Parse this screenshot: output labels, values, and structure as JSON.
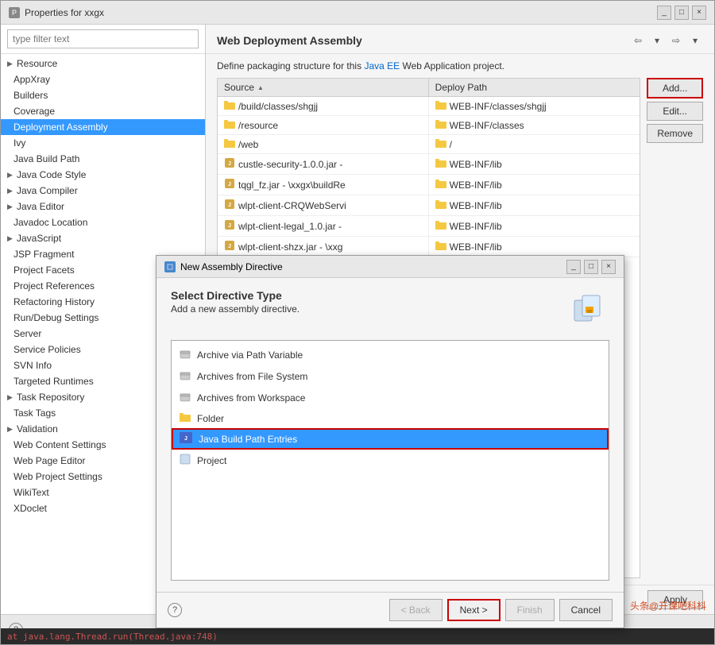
{
  "window": {
    "title": "Properties for xxgx",
    "title_icon": "P",
    "controls": [
      "_",
      "□",
      "×"
    ]
  },
  "sidebar": {
    "filter_placeholder": "type filter text",
    "items": [
      {
        "label": "Resource",
        "has_arrow": true,
        "selected": false
      },
      {
        "label": "AppXray",
        "has_arrow": false,
        "selected": false
      },
      {
        "label": "Builders",
        "has_arrow": false,
        "selected": false
      },
      {
        "label": "Coverage",
        "has_arrow": false,
        "selected": false
      },
      {
        "label": "Deployment Assembly",
        "has_arrow": false,
        "selected": true
      },
      {
        "label": "Ivy",
        "has_arrow": false,
        "selected": false
      },
      {
        "label": "Java Build Path",
        "has_arrow": false,
        "selected": false
      },
      {
        "label": "Java Code Style",
        "has_arrow": true,
        "selected": false
      },
      {
        "label": "Java Compiler",
        "has_arrow": true,
        "selected": false
      },
      {
        "label": "Java Editor",
        "has_arrow": true,
        "selected": false
      },
      {
        "label": "Javadoc Location",
        "has_arrow": false,
        "selected": false
      },
      {
        "label": "JavaScript",
        "has_arrow": true,
        "selected": false
      },
      {
        "label": "JSP Fragment",
        "has_arrow": false,
        "selected": false
      },
      {
        "label": "Project Facets",
        "has_arrow": false,
        "selected": false
      },
      {
        "label": "Project References",
        "has_arrow": false,
        "selected": false
      },
      {
        "label": "Refactoring History",
        "has_arrow": false,
        "selected": false
      },
      {
        "label": "Run/Debug Settings",
        "has_arrow": false,
        "selected": false
      },
      {
        "label": "Server",
        "has_arrow": false,
        "selected": false
      },
      {
        "label": "Service Policies",
        "has_arrow": false,
        "selected": false
      },
      {
        "label": "SVN Info",
        "has_arrow": false,
        "selected": false
      },
      {
        "label": "Targeted Runtimes",
        "has_arrow": false,
        "selected": false
      },
      {
        "label": "Task Repository",
        "has_arrow": true,
        "selected": false
      },
      {
        "label": "Task Tags",
        "has_arrow": false,
        "selected": false
      },
      {
        "label": "Validation",
        "has_arrow": true,
        "selected": false
      },
      {
        "label": "Web Content Settings",
        "has_arrow": false,
        "selected": false
      },
      {
        "label": "Web Page Editor",
        "has_arrow": false,
        "selected": false
      },
      {
        "label": "Web Project Settings",
        "has_arrow": false,
        "selected": false
      },
      {
        "label": "WikiText",
        "has_arrow": false,
        "selected": false
      },
      {
        "label": "XDoclet",
        "has_arrow": false,
        "selected": false
      }
    ]
  },
  "panel": {
    "title": "Web Deployment Assembly",
    "description": "Define packaging structure for this Java EE Web Application project.",
    "description_link": "Java EE",
    "table": {
      "col_source": "Source",
      "col_deploy_path": "Deploy Path",
      "rows": [
        {
          "source": "/build/classes/shgjj",
          "deploy": "WEB-INF/classes/shgjj",
          "source_icon": "folder",
          "deploy_icon": "folder"
        },
        {
          "source": "/resource",
          "deploy": "WEB-INF/classes",
          "source_icon": "folder",
          "deploy_icon": "folder"
        },
        {
          "source": "/web",
          "deploy": "/",
          "source_icon": "folder",
          "deploy_icon": "folder"
        },
        {
          "source": "custle-security-1.0.0.jar -",
          "deploy": "WEB-INF/lib",
          "source_icon": "jar",
          "deploy_icon": "folder"
        },
        {
          "source": "tqgl_fz.jar - \\xxgx\\buildRe",
          "deploy": "WEB-INF/lib",
          "source_icon": "jar",
          "deploy_icon": "folder"
        },
        {
          "source": "wlpt-client-CRQWebServi",
          "deploy": "WEB-INF/lib",
          "source_icon": "jar",
          "deploy_icon": "folder"
        },
        {
          "source": "wlpt-client-legal_1.0.jar -",
          "deploy": "WEB-INF/lib",
          "source_icon": "jar",
          "deploy_icon": "folder"
        },
        {
          "source": "wlpt-client-shzx.jar - \\xxg",
          "deploy": "WEB-INF/lib",
          "source_icon": "jar",
          "deploy_icon": "folder"
        }
      ]
    },
    "buttons": {
      "add": "Add...",
      "edit": "Edit...",
      "remove": "Remove",
      "apply": "Apply"
    }
  },
  "modal": {
    "title": "New Assembly Directive",
    "heading": "Select Directive Type",
    "subtitle": "Add a new assembly directive.",
    "directives": [
      {
        "label": "Archive via Path Variable",
        "icon": "archive",
        "selected": false,
        "highlighted": false
      },
      {
        "label": "Archives from File System",
        "icon": "archive",
        "selected": false,
        "highlighted": false
      },
      {
        "label": "Archives from Workspace",
        "icon": "archive",
        "selected": false,
        "highlighted": false
      },
      {
        "label": "Folder",
        "icon": "folder",
        "selected": false,
        "highlighted": false
      },
      {
        "label": "Java Build Path Entries",
        "icon": "java",
        "selected": true,
        "highlighted": true
      },
      {
        "label": "Project",
        "icon": "project",
        "selected": false,
        "highlighted": false
      }
    ],
    "buttons": {
      "help": "?",
      "back": "< Back",
      "next": "Next >",
      "finish": "Finish",
      "cancel": "Cancel"
    }
  },
  "bottom": {
    "help": "?",
    "code_line": "at java.lang.Thread.run(Thread.java:748)"
  },
  "watermark": "头条@开课吧科枓"
}
